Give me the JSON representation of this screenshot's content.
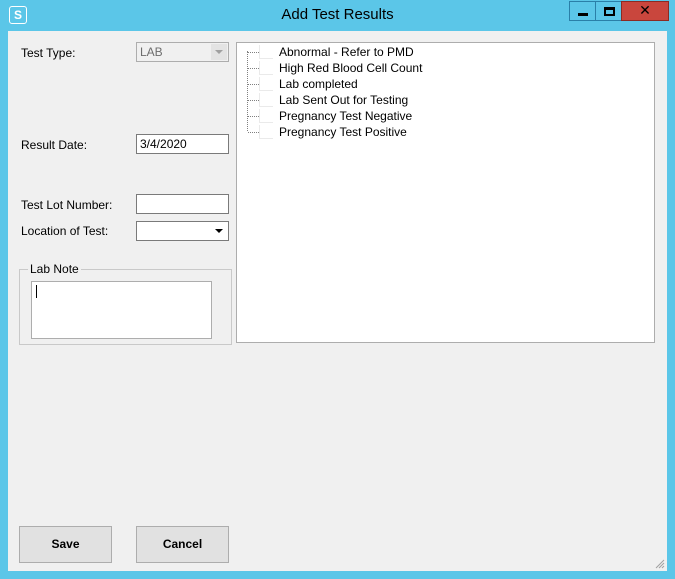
{
  "window": {
    "title": "Add Test Results",
    "app_icon_letter": "S",
    "controls": {
      "minimize_icon": "minimize-icon",
      "maximize_icon": "maximize-icon",
      "close_icon": "close-icon",
      "close_glyph": "✕"
    }
  },
  "form": {
    "test_type": {
      "label": "Test Type:",
      "value": "LAB"
    },
    "result_date": {
      "label": "Result Date:",
      "value": "3/4/2020"
    },
    "test_lot_number": {
      "label": "Test Lot Number:",
      "value": ""
    },
    "location_of_test": {
      "label": "Location of Test:",
      "value": ""
    },
    "lab_note": {
      "label": "Lab Note",
      "value": ""
    }
  },
  "results_list": {
    "items": [
      "Abnormal - Refer to PMD",
      "High Red Blood Cell Count",
      "Lab completed",
      "Lab Sent Out for Testing",
      "Pregnancy Test Negative",
      "Pregnancy Test Positive"
    ]
  },
  "buttons": {
    "save": "Save",
    "cancel": "Cancel"
  },
  "colors": {
    "frame": "#5bc6e8",
    "client": "#f0f0f0",
    "close_button": "#c9463d"
  }
}
